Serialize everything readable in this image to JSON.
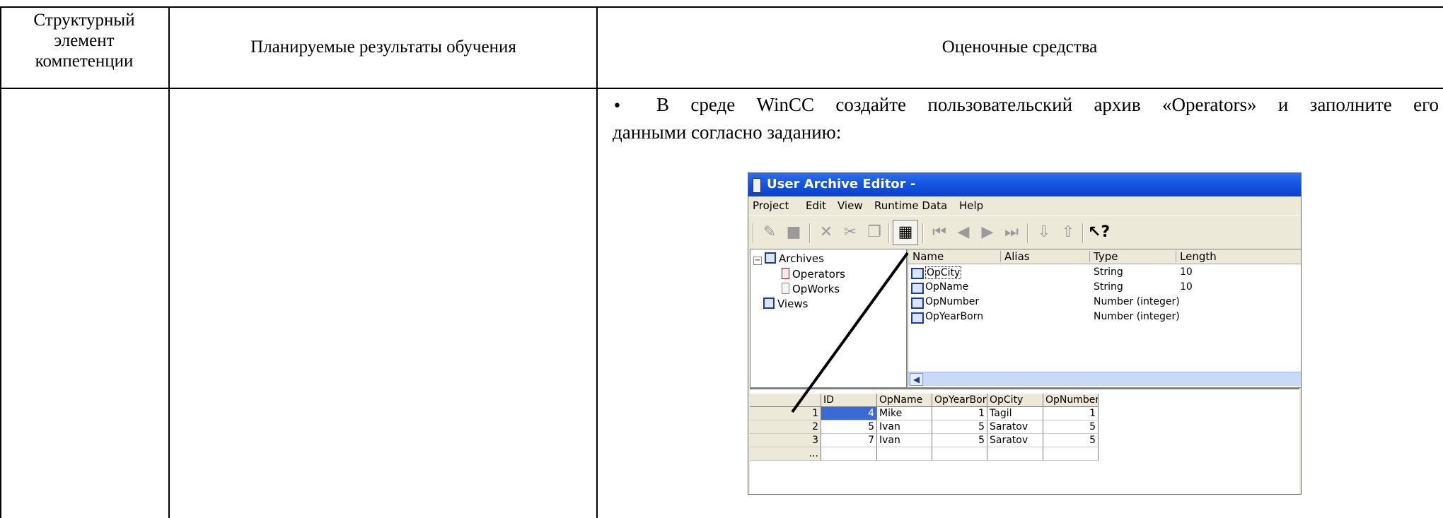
{
  "table": {
    "headers": {
      "col1": "Структурный элемент компетенции",
      "col2": "Планируемые результаты обучения",
      "col3": "Оценочные средства"
    },
    "task": {
      "bullet": "•",
      "line1": "В среде WinCC создайте пользовательский архив «Operators» и заполните его",
      "line2": "данными согласно заданию:"
    }
  },
  "screenshot": {
    "title": "User Archive Editor -",
    "menu": [
      "Project",
      "Edit",
      "View",
      "Runtime Data",
      "Help"
    ],
    "tree": {
      "root": "Archives",
      "children": [
        "Operators",
        "OpWorks"
      ],
      "views": "Views"
    },
    "list": {
      "columns": [
        "Name",
        "Alias",
        "Type",
        "Length"
      ],
      "rows": [
        {
          "name": "OpCity",
          "alias": "",
          "type": "String",
          "length": "10"
        },
        {
          "name": "OpName",
          "alias": "",
          "type": "String",
          "length": "10"
        },
        {
          "name": "OpNumber",
          "alias": "",
          "type": "Number (integer)",
          "length": ""
        },
        {
          "name": "OpYearBorn",
          "alias": "",
          "type": "Number (integer)",
          "length": ""
        }
      ]
    },
    "grid": {
      "columns": [
        "ID",
        "OpName",
        "OpYearBorn",
        "OpCity",
        "OpNumber"
      ],
      "rows": [
        {
          "row": "1",
          "id": "4",
          "opname": "Mike",
          "opyearborn": "1",
          "opcity": "Tagil",
          "opnumber": "1"
        },
        {
          "row": "2",
          "id": "5",
          "opname": "Ivan",
          "opyearborn": "5",
          "opcity": "Saratov",
          "opnumber": "5"
        },
        {
          "row": "3",
          "id": "7",
          "opname": "Ivan",
          "opyearborn": "5",
          "opcity": "Saratov",
          "opnumber": "5"
        }
      ],
      "new_row_marker": "..."
    },
    "colors": {
      "titlebar": "#1456e0",
      "selection": "#3a6ad4",
      "chrome": "#ece9d8"
    }
  }
}
